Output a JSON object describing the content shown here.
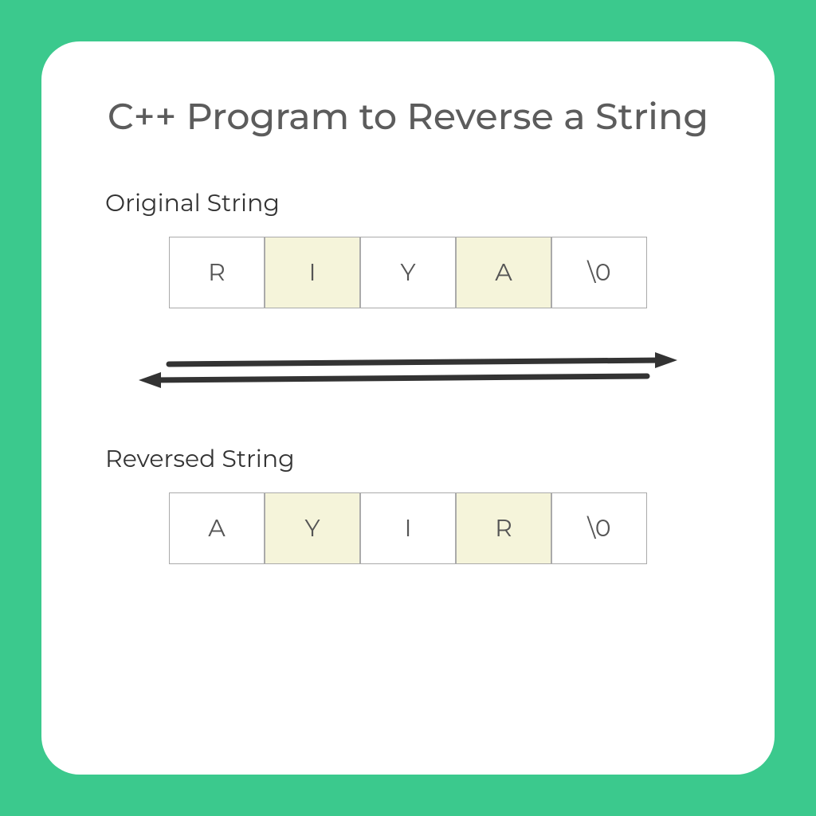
{
  "title": "C++ Program to Reverse a String",
  "original": {
    "label": "Original String",
    "cells": [
      {
        "value": "R",
        "shaded": false
      },
      {
        "value": "I",
        "shaded": true
      },
      {
        "value": "Y",
        "shaded": false
      },
      {
        "value": "A",
        "shaded": true
      },
      {
        "value": "\\0",
        "shaded": false
      }
    ]
  },
  "reversed": {
    "label": "Reversed String",
    "cells": [
      {
        "value": "A",
        "shaded": false
      },
      {
        "value": "Y",
        "shaded": true
      },
      {
        "value": "I",
        "shaded": false
      },
      {
        "value": "R",
        "shaded": true
      },
      {
        "value": "\\0",
        "shaded": false
      }
    ]
  }
}
